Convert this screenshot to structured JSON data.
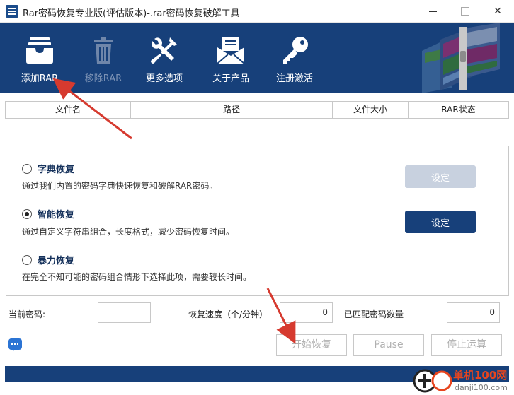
{
  "window": {
    "title": "Rar密码恢复专业版(评估版本)-.rar密码恢复破解工具",
    "controls": [
      "minimize",
      "maximize",
      "close"
    ],
    "close_glyph": "✕"
  },
  "toolbar": {
    "items": [
      {
        "label": "添加RAR",
        "icon": "inbox-tray-icon",
        "enabled": true
      },
      {
        "label": "移除RAR",
        "icon": "trash-icon",
        "enabled": false
      },
      {
        "label": "更多选项",
        "icon": "tools-icon",
        "enabled": true
      },
      {
        "label": "关于产品",
        "icon": "envelope-icon",
        "enabled": true
      },
      {
        "label": "注册激活",
        "icon": "key-icon",
        "enabled": true
      }
    ],
    "banner_icon": "winrar-books-icon"
  },
  "table": {
    "columns": [
      "文件名",
      "路径",
      "文件大小",
      "RAR状态"
    ],
    "rows": []
  },
  "recovery_modes": [
    {
      "title": "字典恢复",
      "description": "通过我们内置的密码字典快速恢复和破解RAR密码。",
      "selected": false,
      "button": "设定",
      "button_enabled": false
    },
    {
      "title": "智能恢复",
      "description": "通过自定义字符串組合，长度格式，减少密码恢复时间。",
      "selected": true,
      "button": "设定",
      "button_enabled": true
    },
    {
      "title": "暴力恢复",
      "description": "在完全不知可能的密码组合情形下选择此项，需要较长时间。",
      "selected": false
    }
  ],
  "stats": {
    "current_password_label": "当前密码:",
    "current_password_value": "",
    "speed_label": "恢复速度（个/分钟）",
    "speed_value": "0",
    "matched_label": "已匹配密码数量",
    "matched_value": "0"
  },
  "actions": {
    "chat_icon": "chat-bubble-icon",
    "start": "开始恢复",
    "pause": "Pause",
    "stop": "停止运算"
  },
  "watermark": {
    "site": "单机100网",
    "domain": "danji100.com"
  },
  "colors": {
    "toolbar_bg": "#17407a",
    "accent_text": "#16325c",
    "disabled_button": "#c8d1df",
    "annotation_arrow": "#d63a2f"
  }
}
